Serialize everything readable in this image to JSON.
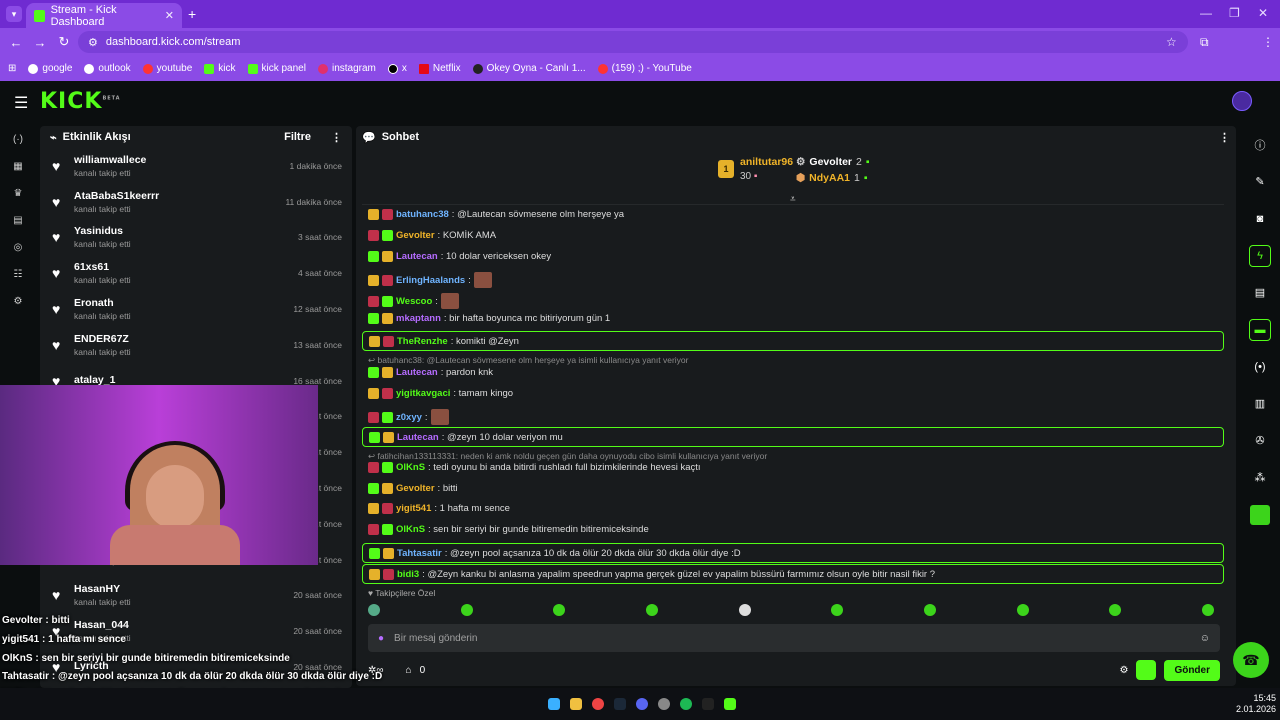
{
  "browser": {
    "tab_title": "Stream - Kick Dashboard",
    "url": "dashboard.kick.com/stream",
    "profile_initial": "Z",
    "bookmarks": [
      "google",
      "outlook",
      "youtube",
      "kick",
      "kick panel",
      "instagram",
      "x",
      "Netflix",
      "Okey Oyna - Canlı 1...",
      "(159) ;) - YouTube"
    ]
  },
  "app": {
    "logo": "KICK",
    "logo_tag": "BETA"
  },
  "activity": {
    "title": "Etkinlik Akışı",
    "filter_label": "Filtre",
    "items": [
      {
        "name": "williamwallece",
        "action": "kanalı takip etti",
        "time": "1 dakika önce"
      },
      {
        "name": "AtaBabaS1keerrr",
        "action": "kanalı takip etti",
        "time": "11 dakika önce"
      },
      {
        "name": "Yasinidus",
        "action": "kanalı takip etti",
        "time": "3 saat önce"
      },
      {
        "name": "61xs61",
        "action": "kanalı takip etti",
        "time": "4 saat önce"
      },
      {
        "name": "Eronath",
        "action": "kanalı takip etti",
        "time": "12 saat önce"
      },
      {
        "name": "ENDER67Z",
        "action": "kanalı takip etti",
        "time": "13 saat önce"
      },
      {
        "name": "atalay_1",
        "action": "",
        "time": "16 saat önce"
      },
      {
        "name": "",
        "action": "",
        "time": "...t önce"
      },
      {
        "name": "",
        "action": "",
        "time": "...t önce"
      },
      {
        "name": "",
        "action": "",
        "time": "...t önce"
      },
      {
        "name": "",
        "action": "",
        "time": "...t önce"
      },
      {
        "name": "",
        "action": "kanalı takip etti",
        "time": "...t önce"
      },
      {
        "name": "HasanHY",
        "action": "kanalı takip etti",
        "time": "20 saat önce"
      },
      {
        "name": "Hasan_044",
        "action": "kanalı takip etti",
        "time": "20 saat önce"
      },
      {
        "name": "Lyricth",
        "action": "",
        "time": "20 saat önce"
      }
    ]
  },
  "chat": {
    "title": "Sohbet",
    "leaderboard": {
      "first_name": "aniltutar96",
      "first_count": "30",
      "second_name": "Gevolter",
      "second_count": "2",
      "third_name": "NdyAA1",
      "third_count": "1"
    },
    "messages": [
      {
        "user": "batuhanc38",
        "color": "#6fb4ff",
        "text": ": @Lautecan sövmesene olm herşeye ya",
        "boxed": false
      },
      {
        "user": "Gevolter",
        "color": "#f0b429",
        "text": ": KOMİK AMA",
        "boxed": false
      },
      {
        "user": "Lautecan",
        "color": "#b56cff",
        "text": ": 10 dolar vericeksen okey",
        "boxed": false
      },
      {
        "user": "ErlingHaalands",
        "color": "#6fb4ff",
        "text": ":",
        "boxed": false,
        "emote": true
      },
      {
        "user": "Wescoo",
        "color": "#53fc18",
        "text": ":",
        "boxed": false,
        "emote": true
      },
      {
        "user": "mkaptann",
        "color": "#b56cff",
        "text": ": bir hafta boyunca mc bitiriyorum gün 1",
        "boxed": false
      },
      {
        "user": "TheRenzhe",
        "color": "#53fc18",
        "text": ": komikti @Zeyn",
        "boxed": true
      },
      {
        "reply": "batuhanc38: @Lautecan sövmesene olm herşeye ya isimli kullanıcıya yanıt veriyor"
      },
      {
        "user": "Lautecan",
        "color": "#b56cff",
        "text": ": pardon knk",
        "boxed": false
      },
      {
        "user": "yigitkavgaci",
        "color": "#53fc18",
        "text": ": tamam kingo",
        "boxed": false
      },
      {
        "user": "z0xyy",
        "color": "#6fb4ff",
        "text": ":",
        "boxed": false,
        "emote": true
      },
      {
        "user": "Lautecan",
        "color": "#b56cff",
        "text": ": @zeyn 10 dolar veriyon mu",
        "boxed": true
      },
      {
        "reply": "fatihcihan133113331: neden ki amk noldu geçen gün daha oynuyodu cibo isimli kullanıcıya yanıt veriyor"
      },
      {
        "user": "OlKnS",
        "color": "#53fc18",
        "text": ": tedi oyunu bi anda bitirdi rushladı full bizimkilerinde hevesi kaçtı",
        "boxed": false
      },
      {
        "user": "Gevolter",
        "color": "#f0b429",
        "text": ": bitti",
        "boxed": false
      },
      {
        "user": "yigit541",
        "color": "#f0b429",
        "text": ": 1 hafta mı sence",
        "boxed": false
      },
      {
        "user": "OlKnS",
        "color": "#53fc18",
        "text": ": sen bir seriyi bir gunde bitiremedin bitiremiceksinde",
        "boxed": false
      },
      {
        "user": "Tahtasatir",
        "color": "#6fb4ff",
        "text": ": @zeyn pool açsanıza 10 dk da ölür 20 dkda ölür 30 dkda ölür diye :D",
        "boxed": true
      },
      {
        "user": "bidi3",
        "color": "#53fc18",
        "text": ": @Zeyn kanku bi anlasma yapalim speedrun yapma gerçek güzel ev yapalim büssürü farmımız olsun oyle bitir nasil fikir ?",
        "boxed": true
      }
    ],
    "followers_label": "Takipçilere Özel",
    "input_placeholder": "Bir mesaj gönderin",
    "points": "0",
    "send_label": "Gönder"
  },
  "overlay": [
    "Gevolter : bitti",
    "yigit541 : 1 hafta mı sence",
    "OlKnS : sen bir seriyi bir gunde bitiremedin bitiremiceksinde",
    "Tahtasatir : @zeyn pool açsanıza 10 dk da ölür 20 dkda ölür 30 dkda ölür diye :D",
    "bidi3 : @Zeyn kanku bi anlasma yapalim speedrun yapma gerçek güzel ev",
    "yapalim büssürü farmımız olsun oyle bitir nasil fikir ?"
  ],
  "taskbar": {
    "time": "15:45",
    "date": "2.01.2026"
  },
  "colors": {
    "kick_green": "#53fc18",
    "browser_purple": "#8b4be6",
    "panel_bg": "#181b1d"
  }
}
